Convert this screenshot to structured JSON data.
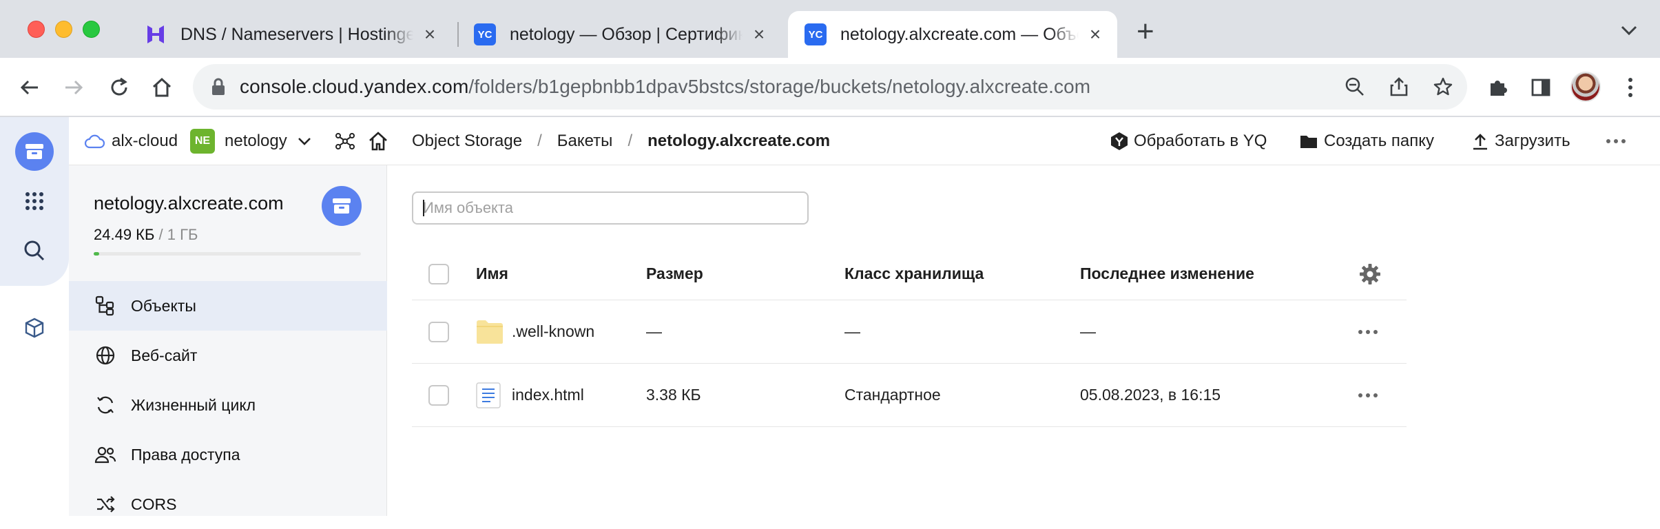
{
  "browser": {
    "tabs": [
      {
        "title": "DNS / Nameservers | Hostinger",
        "favicon": "hostinger-icon"
      },
      {
        "title": "netology — Обзор | Сертификаты",
        "favicon": "yc-icon",
        "favicon_text": "YC"
      },
      {
        "title": "netology.alxcreate.com — Объекты",
        "favicon": "yc-icon",
        "favicon_text": "YC",
        "active": true
      }
    ],
    "url_host": "console.cloud.yandex.com",
    "url_path": "/folders/b1gepbnbb1dpav5bstcs/storage/buckets/netology.alxcreate.com"
  },
  "header": {
    "cloud": "alx-cloud",
    "folder_badge": "NE",
    "folder": "netology",
    "crumbs": [
      "Object Storage",
      "Бакеты",
      "netology.alxcreate.com"
    ],
    "separator": "/",
    "actions": {
      "process_yq": "Обработать в YQ",
      "create_folder": "Создать папку",
      "upload": "Загрузить"
    }
  },
  "bucket": {
    "name": "netology.alxcreate.com",
    "used": "24.49 КБ",
    "quota": "/ 1 ГБ",
    "usage_fraction": 0.02
  },
  "nav": [
    {
      "label": "Объекты",
      "icon": "objects-icon",
      "active": true
    },
    {
      "label": "Веб-сайт",
      "icon": "globe-icon"
    },
    {
      "label": "Жизненный цикл",
      "icon": "lifecycle-icon"
    },
    {
      "label": "Права доступа",
      "icon": "users-icon"
    },
    {
      "label": "CORS",
      "icon": "cors-icon"
    }
  ],
  "search": {
    "placeholder": "Имя объекта"
  },
  "table": {
    "columns": [
      "Имя",
      "Размер",
      "Класс хранилища",
      "Последнее изменение"
    ],
    "rows": [
      {
        "type": "folder",
        "name": ".well-known",
        "size": "—",
        "class": "—",
        "modified": "—"
      },
      {
        "type": "file",
        "name": "index.html",
        "size": "3.38 КБ",
        "class": "Стандартное",
        "modified": "05.08.2023, в 16:15"
      }
    ]
  },
  "colors": {
    "accent": "#5b82f0",
    "folder": "#f8e39a",
    "usage": "#4fb94b"
  }
}
